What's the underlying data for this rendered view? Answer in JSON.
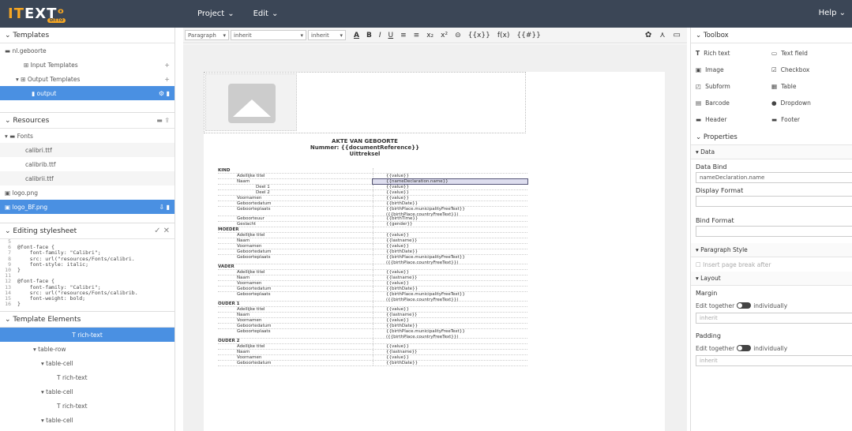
{
  "app": {
    "logo": "ITEXT",
    "logo_sub": "DITTO",
    "menu": [
      "Project",
      "Edit"
    ],
    "help": "Help"
  },
  "templates": {
    "header": "Templates",
    "root": "nl.geboorte",
    "input": "Input Templates",
    "output": "Output Templates",
    "selected": "output"
  },
  "resources": {
    "header": "Resources",
    "fonts_folder": "Fonts",
    "fonts": [
      "calibri.ttf",
      "calibrib.ttf",
      "calibrii.ttf"
    ],
    "images": [
      "logo.png",
      "logo_BF.png"
    ]
  },
  "stylesheet": {
    "header": "Editing stylesheet",
    "lines": [
      "5",
      "6",
      "7",
      "8",
      "9",
      "10",
      "11",
      "12",
      "13",
      "14",
      "15",
      "16"
    ],
    "code": "\n@font-face {\n    font-family: \"Calibri\";\n    src: url(\"resources/Fonts/calibri.\n    font-style: italic;\n}\n\n@font-face {\n    font-family: \"Calibri\";\n    src: url(\"resources/Fonts/calibrib.\n    font-weight: bold;\n}"
  },
  "elements": {
    "header": "Template Elements",
    "items": [
      "rich-text",
      "table-row",
      "table-cell",
      "rich-text",
      "table-cell",
      "rich-text",
      "table-cell"
    ]
  },
  "editor": {
    "paragraph": "Paragraph",
    "inherit1": "inherit",
    "inherit2": "inherit",
    "formats": [
      "A",
      "B",
      "I",
      "U",
      "≡",
      "≡",
      "x₂",
      "x²",
      "⊝",
      "{{x}}",
      "f(x)",
      "{{#}}"
    ]
  },
  "doc": {
    "title": "AKTE VAN GEBOORTE",
    "number": "Nummer: {{documentReference}}",
    "extract": "Uittreksel",
    "rows": [
      [
        "KIND",
        ""
      ],
      [
        "Adellijke titel",
        "{{value}}"
      ],
      [
        "Naam",
        "{{nameDeclaration.name}}"
      ],
      [
        "Deel 1",
        "{{value}}"
      ],
      [
        "Deel 2",
        "{{value}}"
      ],
      [
        "Voornamen",
        "{{value}}"
      ],
      [
        "Geboortedatum",
        "{{birthDate}}"
      ],
      [
        "Geboorteplaats",
        "{{birthPlace.municipalityFreeText}} ({{birthPlace.countryFreeText}})"
      ],
      [
        "Geboorteuur",
        "{{birthTime}}"
      ],
      [
        "Geslacht",
        "{{gender}}"
      ],
      [
        "MOEDER",
        ""
      ],
      [
        "Adellijke titel",
        "{{value}}"
      ],
      [
        "Naam",
        "{{lastname}}"
      ],
      [
        "Voornamen",
        "{{value}}"
      ],
      [
        "Geboortedatum",
        "{{birthDate}}"
      ],
      [
        "Geboorteplaats",
        "{{birthPlace.municipalityFreeText}} ({{birthPlace.countryFreeText}})"
      ],
      [
        "VADER",
        ""
      ],
      [
        "Adellijke titel",
        "{{value}}"
      ],
      [
        "Naam",
        "{{lastname}}"
      ],
      [
        "Voornamen",
        "{{value}}"
      ],
      [
        "Geboortedatum",
        "{{birthDate}}"
      ],
      [
        "Geboorteplaats",
        "{{birthPlace.municipalityFreeText}} ({{birthPlace.countryFreeText}})"
      ],
      [
        "OUDER 1",
        ""
      ],
      [
        "Adellijke titel",
        "{{value}}"
      ],
      [
        "Naam",
        "{{lastname}}"
      ],
      [
        "Voornamen",
        "{{value}}"
      ],
      [
        "Geboortedatum",
        "{{birthDate}}"
      ],
      [
        "Geboorteplaats",
        "{{birthPlace.municipalityFreeText}} ({{birthPlace.countryFreeText}})"
      ],
      [
        "OUDER 2",
        ""
      ],
      [
        "Adellijke titel",
        "{{value}}"
      ],
      [
        "Naam",
        "{{lastname}}"
      ],
      [
        "Voornamen",
        "{{value}}"
      ],
      [
        "Geboortedatum",
        "{{birthDate}}"
      ]
    ]
  },
  "toolbox": {
    "header": "Toolbox",
    "items": [
      "Rich text",
      "Text field",
      "Image",
      "Checkbox",
      "Subform",
      "Table",
      "Barcode",
      "Dropdown",
      "Header",
      "Footer"
    ]
  },
  "properties": {
    "header": "Properties",
    "data": "Data",
    "data_bind": "Data Bind",
    "data_bind_value": "nameDeclaration.name",
    "display_format": "Display Format",
    "bind_format": "Bind Format",
    "para": "Paragraph Style",
    "page_break": "Insert page break after",
    "layout": "Layout",
    "margin": "Margin",
    "edit_together": "Edit together",
    "individually": "individually",
    "inherit": "inherit",
    "padding": "Padding"
  }
}
